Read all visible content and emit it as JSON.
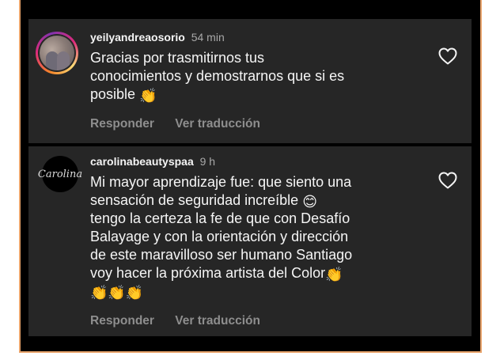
{
  "comments": [
    {
      "username": "yeilyandreaosorio",
      "time": "54 min",
      "lines": [
        "Gracias por trasmitirnos tus",
        "conocimientos y demostrarnos que si es",
        "posible"
      ],
      "actions": {
        "reply": "Responder",
        "translate": "Ver traducción"
      },
      "avatar_icon": "profile-photo-two-women",
      "like_icon": "heart-outline-icon"
    },
    {
      "username": "carolinabeautyspaa",
      "time": "9 h",
      "avatar_text": "Carolina",
      "lines": [
        "Mi mayor aprendizaje fue: que siento una",
        "sensación de seguridad increíble",
        "tengo la certeza la fe de que con Desafío",
        "Balayage y con la orientación y dirección",
        "de este maravilloso ser humano Santiago",
        "voy hacer la próxima artista del Color"
      ],
      "actions": {
        "reply": "Responder",
        "translate": "Ver traducción"
      },
      "avatar_icon": "carolina-beauty-spa-logo",
      "like_icon": "heart-outline-icon"
    }
  ],
  "emojis": {
    "clap": "👏",
    "smile": "😊"
  },
  "colors": {
    "card_bg": "#262626",
    "frame_bg": "#000000",
    "text_primary": "#f5f5f5",
    "text_secondary": "#a8a8a8",
    "action_text": "#8e8e8e",
    "frame_border": "#e8a36a"
  }
}
